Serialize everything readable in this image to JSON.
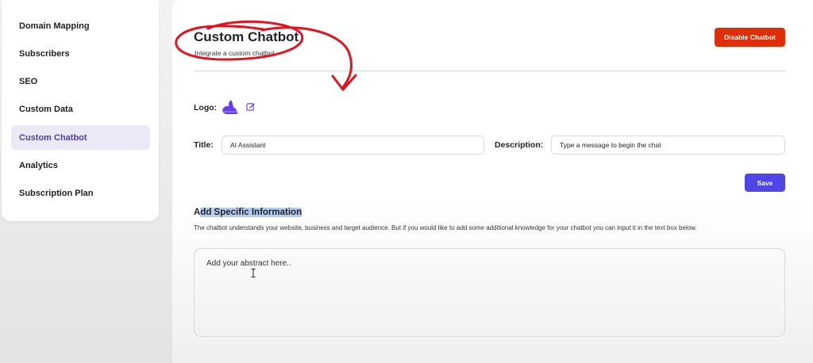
{
  "sidebar": {
    "items": [
      {
        "label": "Domain Mapping"
      },
      {
        "label": "Subscribers"
      },
      {
        "label": "SEO"
      },
      {
        "label": "Custom Data"
      },
      {
        "label": "Custom Chatbot",
        "active": true
      },
      {
        "label": "Analytics"
      },
      {
        "label": "Subscription Plan"
      }
    ]
  },
  "header": {
    "title": "Custom Chatbot",
    "subtitle": "Integrate a custom chatbot.",
    "disable_label": "Disable Chatbot"
  },
  "form": {
    "logo_label": "Logo:",
    "title_label": "Title:",
    "title_value": "AI Assistant",
    "description_label": "Description:",
    "description_value": "Type a message to begin the chat",
    "save_label": "Save"
  },
  "specific_info": {
    "heading_first": "A",
    "heading_rest": "dd Specific Information",
    "description": "The chatbot understands your website, business and target audience. But if you would like to add some additional knowledge for your chatbot you can input it in the text box below.",
    "placeholder": "Add your abstract here.."
  },
  "colors": {
    "accent": "#4e46e5",
    "danger": "#dc2f0a",
    "active_bg": "#ebe9f6",
    "annotation": "#e0141e"
  },
  "icons": [
    "logo-icon",
    "edit-icon",
    "text-cursor-icon"
  ]
}
